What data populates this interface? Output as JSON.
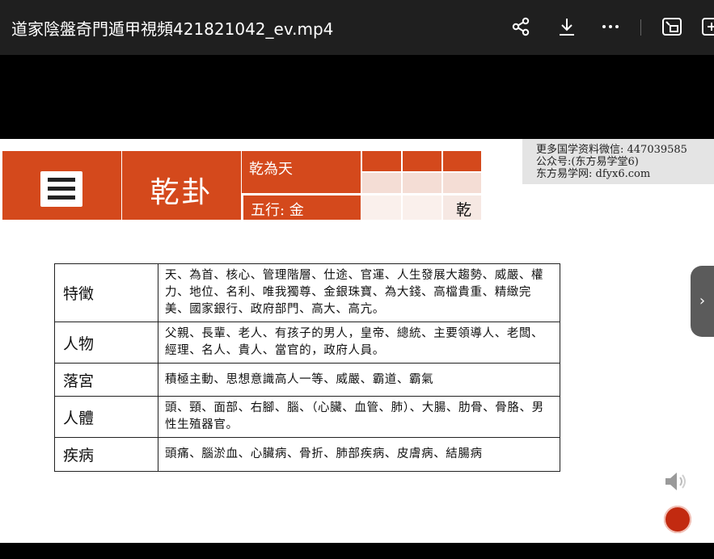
{
  "window": {
    "title": "道家陰盤奇門遁甲視頻421821042_ev.mp4",
    "icons": [
      "share-icon",
      "download-icon",
      "more-icon",
      "picture-in-picture-icon",
      "add-icon"
    ]
  },
  "slide": {
    "gua_title": "乾卦",
    "row1_text": "乾為天",
    "row2_text": "五行: 金",
    "small_gua": "乾",
    "watermark": [
      "更多国学资料微信: 447039585",
      "公众号:(东方易学堂6)",
      "东方易学网: dfyx6.com"
    ],
    "table": [
      {
        "key": "特徵",
        "value": "天、為首、核心、管理階層、仕途、官運、人生發展大趨勢、威嚴、權力、地位、名利、唯我獨尊、金銀珠寶、為大錢、高檔貴重、精緻完美、國家銀行、政府部門、高大、高亢。"
      },
      {
        "key": "人物",
        "value": "父親、長輩、老人、有孩子的男人，皇帝、總統、主要領導人、老闆、經理、名人、貴人、當官的，政府人員。"
      },
      {
        "key": "落宮",
        "value": "積極主動、思想意識高人一等、威嚴、霸道、霸氣"
      },
      {
        "key": "人體",
        "value": "頭、頸、面部、右腳、腦、（心臟、血管、肺）、大腸、肋骨、骨胳、男性生殖器官。"
      },
      {
        "key": "疾病",
        "value": "頭痛、腦淤血、心臟病、骨折、肺部疾病、皮膚病、結腸病"
      }
    ]
  },
  "colors": {
    "accent": "#d4491c",
    "light_cell": "#f4ddd5",
    "record": "#c22a10"
  }
}
